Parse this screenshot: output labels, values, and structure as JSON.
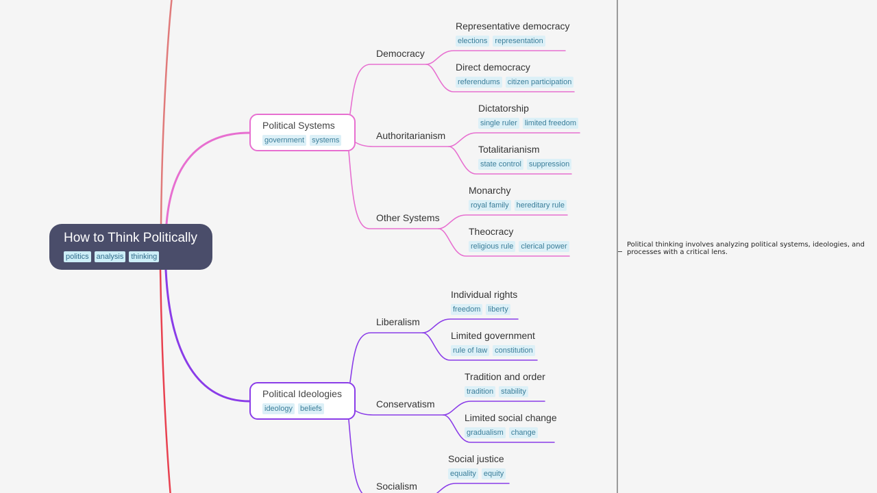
{
  "colors": {
    "root_bg": "#4a4d6a",
    "edge_top_outer": "#e07a7a",
    "edge_bottom_outer": "#e8404f",
    "systems_branch": "#e76fd0",
    "ideologies_branch": "#8a3ce8",
    "tag_bg": "#dcf0f7",
    "tag_text": "#3a7d99"
  },
  "root": {
    "title": "How to Think Politically",
    "tags": [
      "politics",
      "analysis",
      "thinking"
    ]
  },
  "branches": [
    {
      "title": "Political Systems",
      "tags": [
        "government",
        "systems"
      ],
      "children": [
        {
          "title": "Democracy",
          "children": [
            {
              "title": "Representative democracy",
              "tags": [
                "elections",
                "representation"
              ]
            },
            {
              "title": "Direct democracy",
              "tags": [
                "referendums",
                "citizen participation"
              ]
            }
          ]
        },
        {
          "title": "Authoritarianism",
          "children": [
            {
              "title": "Dictatorship",
              "tags": [
                "single ruler",
                "limited freedom"
              ]
            },
            {
              "title": "Totalitarianism",
              "tags": [
                "state control",
                "suppression"
              ]
            }
          ]
        },
        {
          "title": "Other Systems",
          "children": [
            {
              "title": "Monarchy",
              "tags": [
                "royal family",
                "hereditary rule"
              ]
            },
            {
              "title": "Theocracy",
              "tags": [
                "religious rule",
                "clerical power"
              ]
            }
          ]
        }
      ]
    },
    {
      "title": "Political Ideologies",
      "tags": [
        "ideology",
        "beliefs"
      ],
      "children": [
        {
          "title": "Liberalism",
          "children": [
            {
              "title": "Individual rights",
              "tags": [
                "freedom",
                "liberty"
              ]
            },
            {
              "title": "Limited government",
              "tags": [
                "rule of law",
                "constitution"
              ]
            }
          ]
        },
        {
          "title": "Conservatism",
          "children": [
            {
              "title": "Tradition and order",
              "tags": [
                "tradition",
                "stability"
              ]
            },
            {
              "title": "Limited social change",
              "tags": [
                "gradualism",
                "change"
              ]
            }
          ]
        },
        {
          "title": "Socialism",
          "children": [
            {
              "title": "Social justice",
              "tags": [
                "equality",
                "equity"
              ]
            }
          ]
        }
      ]
    }
  ],
  "sidebar": {
    "note": "Political thinking involves analyzing political systems, ideologies, and processes with a critical lens."
  }
}
